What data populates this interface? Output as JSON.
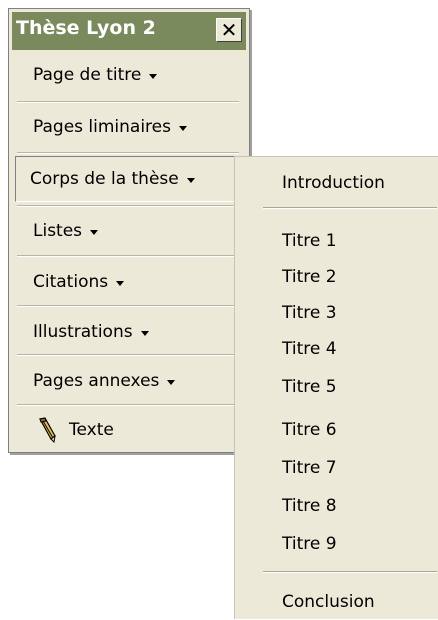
{
  "toolbar": {
    "title": "Thèse Lyon 2",
    "close_label": "✕",
    "items": [
      {
        "label": "Page de titre",
        "has_dropdown": true
      },
      {
        "label": "Pages liminaires",
        "has_dropdown": true
      },
      {
        "label": "Corps de la thèse",
        "has_dropdown": true,
        "active": true
      },
      {
        "label": "Listes",
        "has_dropdown": true
      },
      {
        "label": "Citations",
        "has_dropdown": true
      },
      {
        "label": "Illustrations",
        "has_dropdown": true
      },
      {
        "label": "Pages annexes",
        "has_dropdown": true
      },
      {
        "label": "Texte",
        "icon": "pencil-icon"
      }
    ]
  },
  "submenu": {
    "items": [
      {
        "label": "Introduction"
      },
      {
        "label": "Titre 1"
      },
      {
        "label": "Titre 2"
      },
      {
        "label": "Titre 3"
      },
      {
        "label": "Titre 4"
      },
      {
        "label": "Titre 5"
      },
      {
        "label": "Titre 6"
      },
      {
        "label": "Titre 7"
      },
      {
        "label": "Titre 8"
      },
      {
        "label": "Titre 9"
      },
      {
        "label": "Conclusion"
      }
    ]
  },
  "colors": {
    "titlebar": "#7b8a5c",
    "menu_background": "#ece9d8"
  }
}
